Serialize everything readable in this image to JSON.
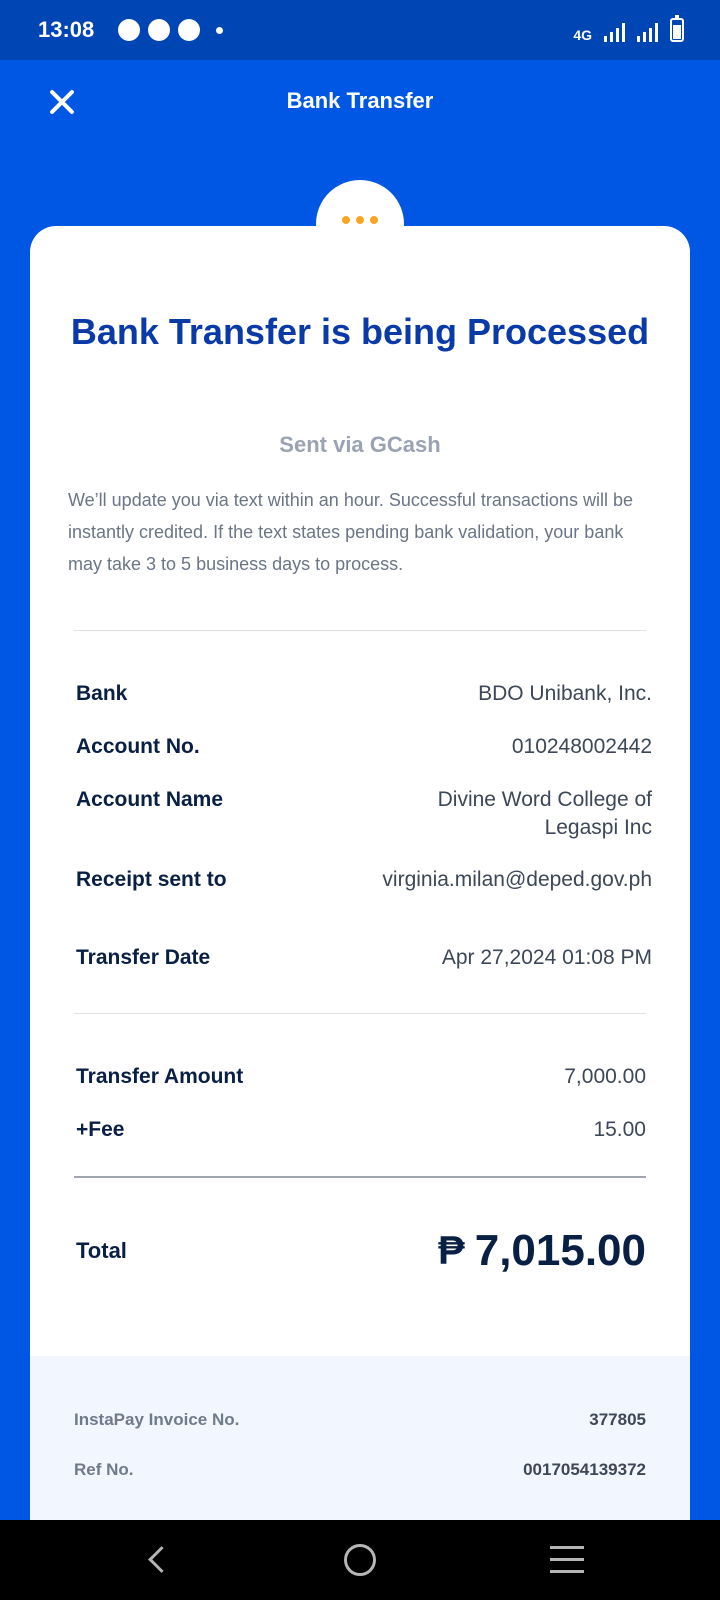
{
  "status_bar": {
    "time": "13:08",
    "network": "4G",
    "left_icons": [
      "messenger-icon",
      "chat-icon",
      "speed-icon"
    ]
  },
  "header": {
    "title": "Bank Transfer",
    "close_icon": "close-icon"
  },
  "status_indicator": {
    "icon": "pending-dots-icon",
    "color": "#f6a623"
  },
  "card": {
    "title": "Bank Transfer is being Processed",
    "subtitle": "Sent via GCash",
    "description": "We’ll update you via text within an hour. Successful transactions will be instantly credited. If the text states pending bank validation, your bank may take 3 to 5 business days to process."
  },
  "details": [
    {
      "label": "Bank",
      "value": "BDO Unibank, Inc."
    },
    {
      "label": "Account No.",
      "value": "010248002442"
    },
    {
      "label": "Account Name",
      "value": "Divine Word College of Legaspi Inc"
    },
    {
      "label": "Receipt sent to",
      "value": "virginia.milan@deped.gov.ph"
    },
    {
      "label": "Transfer Date",
      "value": "Apr 27,2024 01:08 PM"
    }
  ],
  "amounts": [
    {
      "label": "Transfer Amount",
      "value": "7,000.00"
    },
    {
      "label": "+Fee",
      "value": "15.00"
    }
  ],
  "total": {
    "label": "Total",
    "currency": "₱",
    "value": "7,015.00"
  },
  "footer": [
    {
      "label": "InstaPay Invoice No.",
      "value": "377805"
    },
    {
      "label": "Ref No.",
      "value": "0017054139372"
    }
  ],
  "colors": {
    "brand_blue": "#0057e4",
    "title_blue": "#0a3aa8",
    "pending_orange": "#f6a623"
  }
}
